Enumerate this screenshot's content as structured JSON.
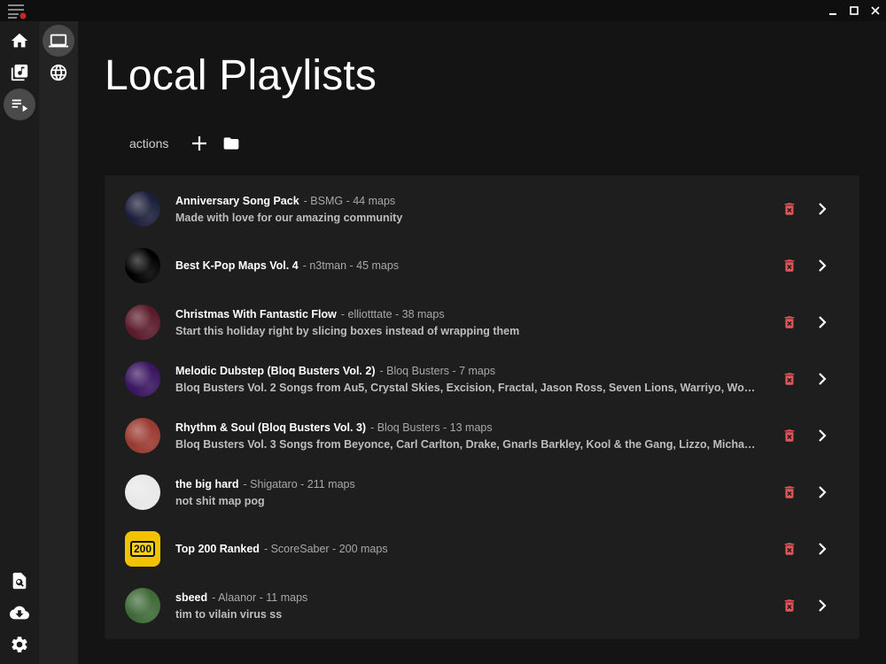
{
  "colors": {
    "accent_delete": "#e05555",
    "background": "#141414",
    "panel": "#1e1e1e"
  },
  "window": {
    "controls": [
      "minimize-icon",
      "maximize-icon",
      "close-icon"
    ]
  },
  "rail": {
    "items": [
      {
        "icon": "home-icon",
        "active": false
      },
      {
        "icon": "music-library-icon",
        "active": false
      },
      {
        "icon": "playlist-icon",
        "active": true
      }
    ],
    "bottom_items": [
      {
        "icon": "search-map-icon"
      },
      {
        "icon": "cloud-download-icon"
      },
      {
        "icon": "gear-icon"
      }
    ]
  },
  "subrail": {
    "items": [
      {
        "icon": "laptop-icon",
        "active": true
      },
      {
        "icon": "globe-icon",
        "active": false
      }
    ]
  },
  "page": {
    "title": "Local Playlists"
  },
  "actions": {
    "label": "actions",
    "icons": [
      "add-icon",
      "folder-icon"
    ]
  },
  "playlists": [
    {
      "name": "Anniversary Song Pack",
      "meta": "- BSMG - 44 maps",
      "description": "Made with love for our amazing community",
      "thumb_color": "#1b1f3a"
    },
    {
      "name": "Best K-Pop Maps Vol. 4",
      "meta": "- n3tman - 45 maps",
      "description": "",
      "thumb_color": "#000000"
    },
    {
      "name": "Christmas With Fantastic Flow",
      "meta": "- elliotttate - 38 maps",
      "description": "Start this holiday right by slicing boxes instead of wrapping them",
      "thumb_color": "#5a1a2a"
    },
    {
      "name": "Melodic Dubstep (Bloq Busters Vol. 2)",
      "meta": "- Bloq Busters - 7 maps",
      "description": "Bloq Busters Vol. 2 Songs from Au5, Crystal Skies, Excision, Fractal, Jason Ross, Seven Lions, Warriyo, Wooli, and Zeds Dead",
      "thumb_color": "#3a1560"
    },
    {
      "name": "Rhythm & Soul (Bloq Busters Vol. 3)",
      "meta": "- Bloq Busters - 13 maps",
      "description": "Bloq Busters Vol. 3 Songs from Beyonce, Carl Carlton, Drake, Gnarls Barkley, Kool & the Gang, Lizzo, Michael Jackson and more",
      "thumb_color": "#9a3a30"
    },
    {
      "name": "the big hard",
      "meta": "- Shigataro - 211 maps",
      "description": "not shit map pog",
      "thumb_color": "#e8e8e8"
    },
    {
      "name": "Top 200 Ranked",
      "meta": "- ScoreSaber - 200 maps",
      "description": "",
      "thumb_color": "#f2c200",
      "thumb_text": "200"
    },
    {
      "name": "sbeed",
      "meta": "- Alaanor - 11 maps",
      "description": "tim to vilain virus ss",
      "thumb_color": "#3f6a38"
    }
  ]
}
